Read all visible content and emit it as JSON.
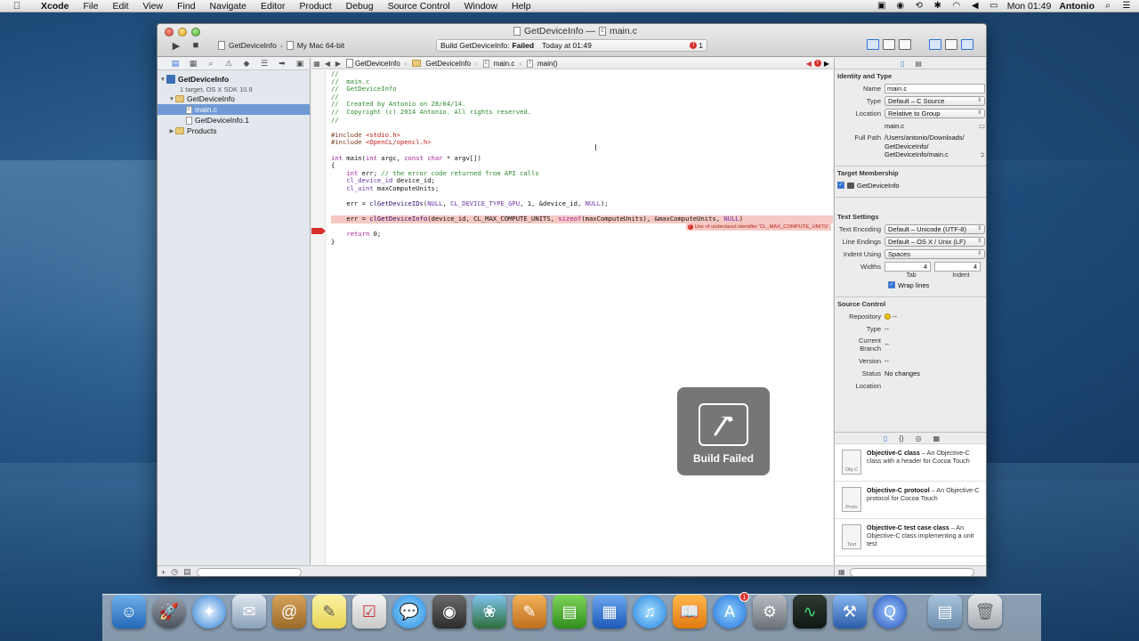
{
  "menubar": {
    "app": "Xcode",
    "items": [
      "File",
      "Edit",
      "View",
      "Find",
      "Navigate",
      "Editor",
      "Product",
      "Debug",
      "Source Control",
      "Window",
      "Help"
    ],
    "clock": "Mon 01:49",
    "user": "Antonio"
  },
  "window": {
    "title": "GetDeviceInfo — ",
    "title_file": "main.c"
  },
  "toolbar": {
    "scheme": "GetDeviceInfo",
    "destination": "My Mac 64-bit",
    "activity_prefix": "Build GetDeviceInfo:",
    "activity_status": "Failed",
    "activity_time": "Today at 01:49",
    "error_count": "1"
  },
  "navigator": {
    "project_name": "GetDeviceInfo",
    "project_sub": "1 target, OS X SDK 10.9",
    "group": "GetDeviceInfo",
    "files": [
      "main.c",
      "GetDeviceInfo.1"
    ],
    "products": "Products"
  },
  "jumpbar": {
    "crumbs": [
      "GetDeviceInfo",
      "GetDeviceInfo",
      "main.c",
      "main()"
    ]
  },
  "code": {
    "error_message": "Use of undeclared identifier 'CL_MAX_COMPUTE_UNITS'"
  },
  "hud": {
    "label": "Build Failed"
  },
  "inspector": {
    "identity_title": "Identity and Type",
    "name_label": "Name",
    "name_value": "main.c",
    "type_label": "Type",
    "type_value": "Default – C Source",
    "location_label": "Location",
    "location_value": "Relative to Group",
    "location_file": "main.c",
    "fullpath_label": "Full Path",
    "fullpath_value": [
      "/Users/antonio/Downloads/",
      "GetDeviceInfo/",
      "GetDeviceInfo/main.c"
    ],
    "membership_title": "Target Membership",
    "membership_target": "GetDeviceInfo",
    "text_title": "Text Settings",
    "encoding_label": "Text Encoding",
    "encoding_value": "Default – Unicode (UTF-8)",
    "endings_label": "Line Endings",
    "endings_value": "Default – OS X / Unix (LF)",
    "indent_label": "Indent Using",
    "indent_value": "Spaces",
    "widths_label": "Widths",
    "tab_width": "4",
    "indent_width": "4",
    "tab_caption": "Tab",
    "indent_caption": "Indent",
    "wrap_label": "Wrap lines",
    "sc_title": "Source Control",
    "repo_label": "Repository",
    "repo_value": "--",
    "sc_type_label": "Type",
    "sc_type_value": "--",
    "branch_label": "Current Branch",
    "branch_value": "--",
    "version_label": "Version",
    "version_value": "--",
    "status_label": "Status",
    "status_value": "No changes",
    "sc_location_label": "Location"
  },
  "library": {
    "items": [
      {
        "title": "Objective-C class",
        "desc": " – An Objective-C class with a header for Cocoa Touch",
        "icon": "Obj-C"
      },
      {
        "title": "Objective-C protocol",
        "desc": " – An Objective-C protocol for Cocoa Touch",
        "icon": "Proto"
      },
      {
        "title": "Objective-C test case class",
        "desc": " – An Objective-C class implementing a unit test",
        "icon": "Test"
      }
    ]
  },
  "dock": {
    "badge_app_store": "1"
  },
  "colors": {
    "error_red": "#d9302c",
    "selection_blue": "#6f9ad4",
    "comment_green": "#2e8b2e",
    "keyword_purple": "#a8239b"
  }
}
